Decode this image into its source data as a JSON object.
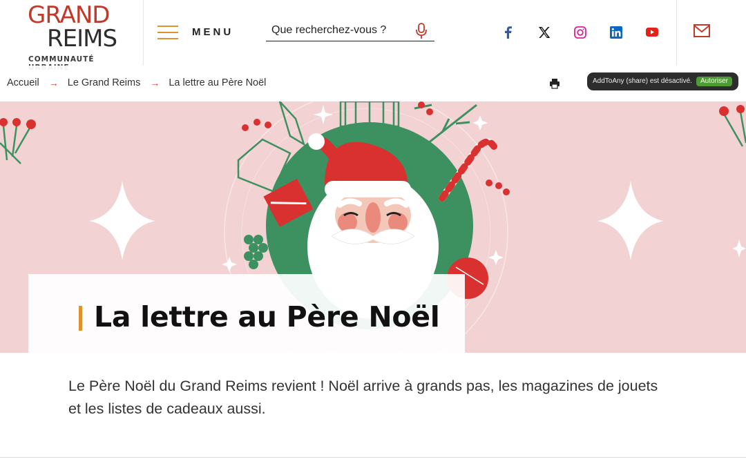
{
  "logo": {
    "line1": "GRAND",
    "line2": "REIMS",
    "line3": "COMMUNAUTÉ URBAINE"
  },
  "header": {
    "menu_label": "MENU",
    "search_placeholder": "Que recherchez-vous ?",
    "socials": [
      "facebook-icon",
      "x-icon",
      "instagram-icon",
      "linkedin-icon",
      "youtube-icon"
    ],
    "mail_icon": "mail-icon"
  },
  "breadcrumb": {
    "items": [
      "Accueil",
      "Le Grand Reims",
      "La lettre au Père Noël"
    ]
  },
  "share": {
    "text": "AddToAny (share) est désactivé.",
    "button": "Autoriser"
  },
  "page": {
    "title": "La lettre au Père Noël",
    "intro": "Le Père Noël du Grand Reims revient ! Noël arrive à grands pas, les magazines de jouets et les listes de cadeaux aussi."
  },
  "colors": {
    "brand_red": "#c0392b",
    "brand_orange": "#e0922a",
    "hero_pink": "#f2d2d3",
    "santa_green": "#3d9160",
    "santa_red": "#d8312f",
    "facebook": "#3b5998",
    "instagram": "#d6249f",
    "linkedin": "#0a66c2",
    "youtube": "#e62117",
    "share_allow": "#4e9a33"
  }
}
